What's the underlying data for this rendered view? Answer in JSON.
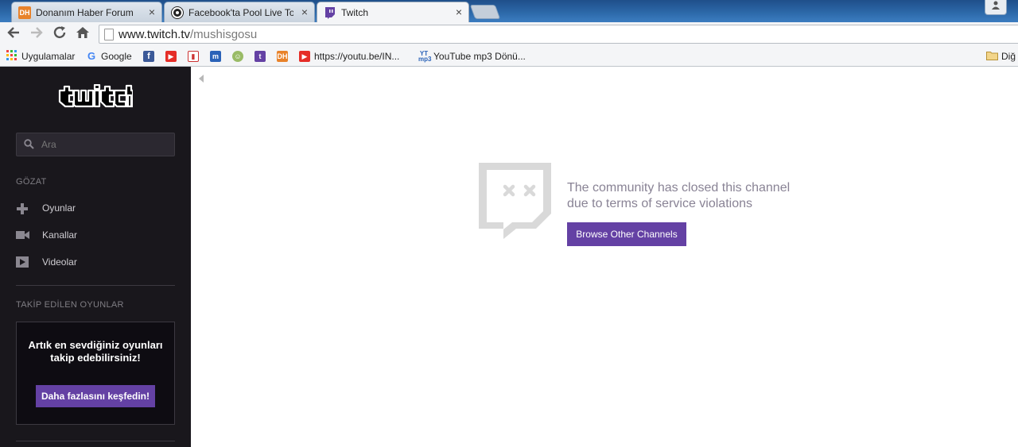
{
  "browser": {
    "tabs": [
      {
        "title": "Donanım Haber Forum",
        "favicon": "DH",
        "close": "×"
      },
      {
        "title": "Facebook'ta Pool Live Tou",
        "favicon": "pool-icon",
        "close": "×"
      },
      {
        "title": "Twitch",
        "favicon": "twitch-icon",
        "close": "×"
      }
    ],
    "url_host": "www.twitch.tv",
    "url_path": "/mushisgosu",
    "bookmarks": [
      {
        "label": "Uygulamalar",
        "icon": "apps-grid-icon"
      },
      {
        "label": "Google",
        "icon": "google-icon"
      },
      {
        "label": "",
        "icon": "facebook-icon"
      },
      {
        "label": "",
        "icon": "youtube-icon"
      },
      {
        "label": "",
        "icon": "popcorn-icon"
      },
      {
        "label": "",
        "icon": "m-icon"
      },
      {
        "label": "",
        "icon": "globe-icon"
      },
      {
        "label": "",
        "icon": "twitch-icon"
      },
      {
        "label": "",
        "icon": "dh-icon"
      },
      {
        "label": "https://youtu.be/IN...",
        "icon": "youtube-icon"
      },
      {
        "label": "YouTube mp3 Dönü...",
        "icon": "ytmp3-icon"
      }
    ],
    "other_bookmarks": "Diğ"
  },
  "sidebar": {
    "search_placeholder": "Ara",
    "browse_header": "GÖZAT",
    "nav": [
      {
        "label": "Oyunlar",
        "icon": "gamepad-icon"
      },
      {
        "label": "Kanallar",
        "icon": "camera-icon"
      },
      {
        "label": "Videolar",
        "icon": "play-icon"
      }
    ],
    "followed_header": "TAKİP EDİLEN OYUNLAR",
    "promo_text": "Artık en sevdiğiniz oyunları takip edebilirsiniz!",
    "promo_button": "Daha fazlasını keşfedin!"
  },
  "main": {
    "message_line1": "The community has closed this channel",
    "message_line2": "due to terms of service violations",
    "button": "Browse Other Channels"
  },
  "colors": {
    "twitch_purple": "#6441a4",
    "sidebar_bg": "#19171c",
    "message_text": "#898395"
  }
}
